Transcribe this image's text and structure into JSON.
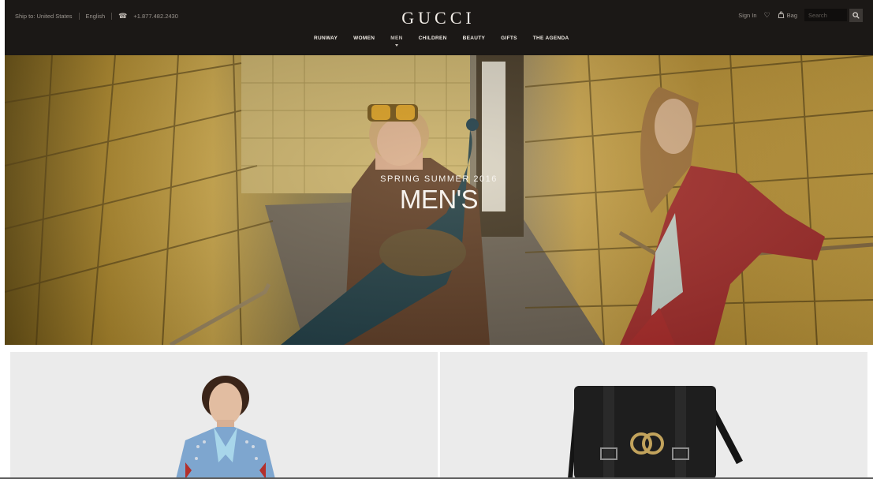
{
  "header": {
    "ship_to": "Ship to: United States",
    "language": "English",
    "phone": "+1.877.482.2430",
    "logo": "GUCCI",
    "sign_in": "Sign In",
    "bag": "Bag",
    "search_placeholder": "Search",
    "icons": {
      "phone": "phone-icon",
      "wishlist": "heart-icon",
      "bag": "bag-icon",
      "search": "search-icon"
    }
  },
  "nav": {
    "items": [
      "RUNWAY",
      "WOMEN",
      "MEN",
      "CHILDREN",
      "BEAUTY",
      "GIFTS",
      "THE AGENDA"
    ],
    "active": "MEN"
  },
  "hero": {
    "subtitle": "SPRING SUMMER 2016",
    "title": "MEN'S"
  },
  "colors": {
    "header_bg": "#1b1816",
    "panel_bg": "#ebebeb",
    "hero_text": "#f7f3ee"
  }
}
